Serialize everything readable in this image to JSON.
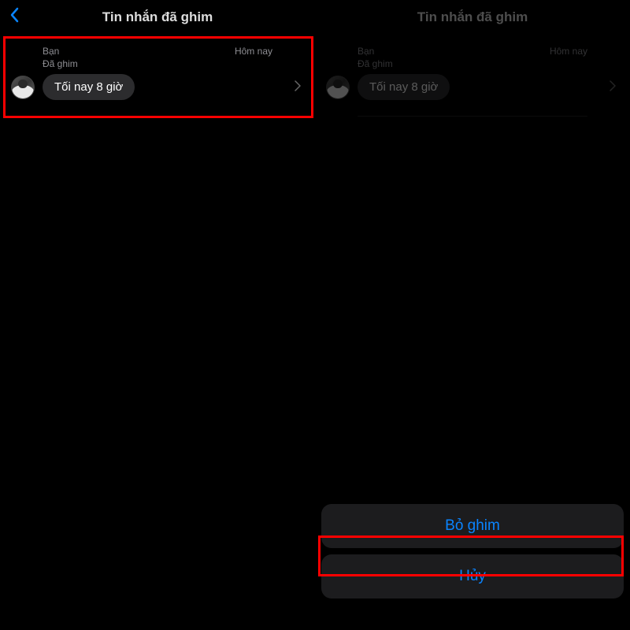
{
  "left_panel": {
    "header": {
      "title": "Tin nhắn đã ghim"
    },
    "content": {
      "sender": "Bạn",
      "timestamp": "Hôm nay",
      "pinned_label": "Đã ghim",
      "message_text": "Tối nay 8 giờ"
    }
  },
  "right_panel": {
    "header": {
      "title": "Tin nhắn đã ghim"
    },
    "content": {
      "sender": "Bạn",
      "timestamp": "Hôm nay",
      "pinned_label": "Đã ghim",
      "message_text": "Tối nay 8 giờ"
    },
    "action_sheet": {
      "unpin_label": "Bỏ ghim",
      "cancel_label": "Hủy"
    }
  }
}
